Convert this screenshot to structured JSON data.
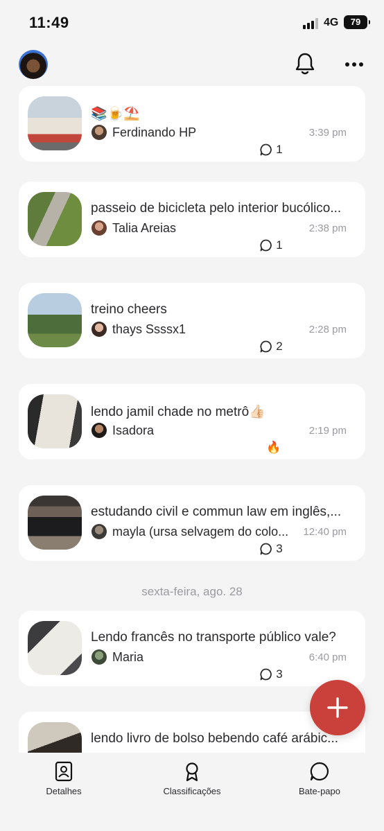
{
  "status_bar": {
    "time": "11:49",
    "network": "4G",
    "battery": "79"
  },
  "header": {
    "notifications_icon": "bell-icon",
    "menu_icon": "more-icon"
  },
  "posts": [
    {
      "title": "📚🍺⛱️",
      "author": "Ferdinando HP",
      "time": "3:39 pm",
      "reaction": {
        "type": "comments",
        "count": "1"
      }
    },
    {
      "title": "passeio de bicicleta pelo interior bucólico...",
      "author": "Talia Areias",
      "time": "2:38 pm",
      "reaction": {
        "type": "comments",
        "count": "1"
      }
    },
    {
      "title": "treino cheers",
      "author": "thays Ssssx1",
      "time": "2:28 pm",
      "reaction": {
        "type": "comments",
        "count": "2"
      }
    },
    {
      "title": "lendo jamil chade no metrô👍🏻",
      "author": "Isadora",
      "time": "2:19 pm",
      "reaction": {
        "type": "emoji",
        "emoji": "🔥"
      }
    },
    {
      "title": "estudando civil e commun law em inglês,...",
      "author": "mayla (ursa selvagem do colo...",
      "time": "12:40 pm",
      "reaction": {
        "type": "comments",
        "count": "3"
      }
    },
    {
      "title": "Lendo francês no transporte público vale?",
      "author": "Maria",
      "time": "6:40 pm",
      "reaction": {
        "type": "comments",
        "count": "3"
      }
    },
    {
      "title": "lendo livro de bolso bebendo café arábic..."
    }
  ],
  "day_separator": "sexta-feira, ago. 28",
  "fab": {
    "icon": "plus-icon"
  },
  "bottom_nav": {
    "items": [
      {
        "label": "Detalhes",
        "icon": "contact-book-icon"
      },
      {
        "label": "Classificações",
        "icon": "award-ribbon-icon"
      },
      {
        "label": "Bate-papo",
        "icon": "chat-bubble-icon"
      }
    ]
  },
  "colors": {
    "accent": "#c9413a",
    "background": "#f4f4f5",
    "card": "#ffffff",
    "muted_text": "#9a9aa0"
  }
}
